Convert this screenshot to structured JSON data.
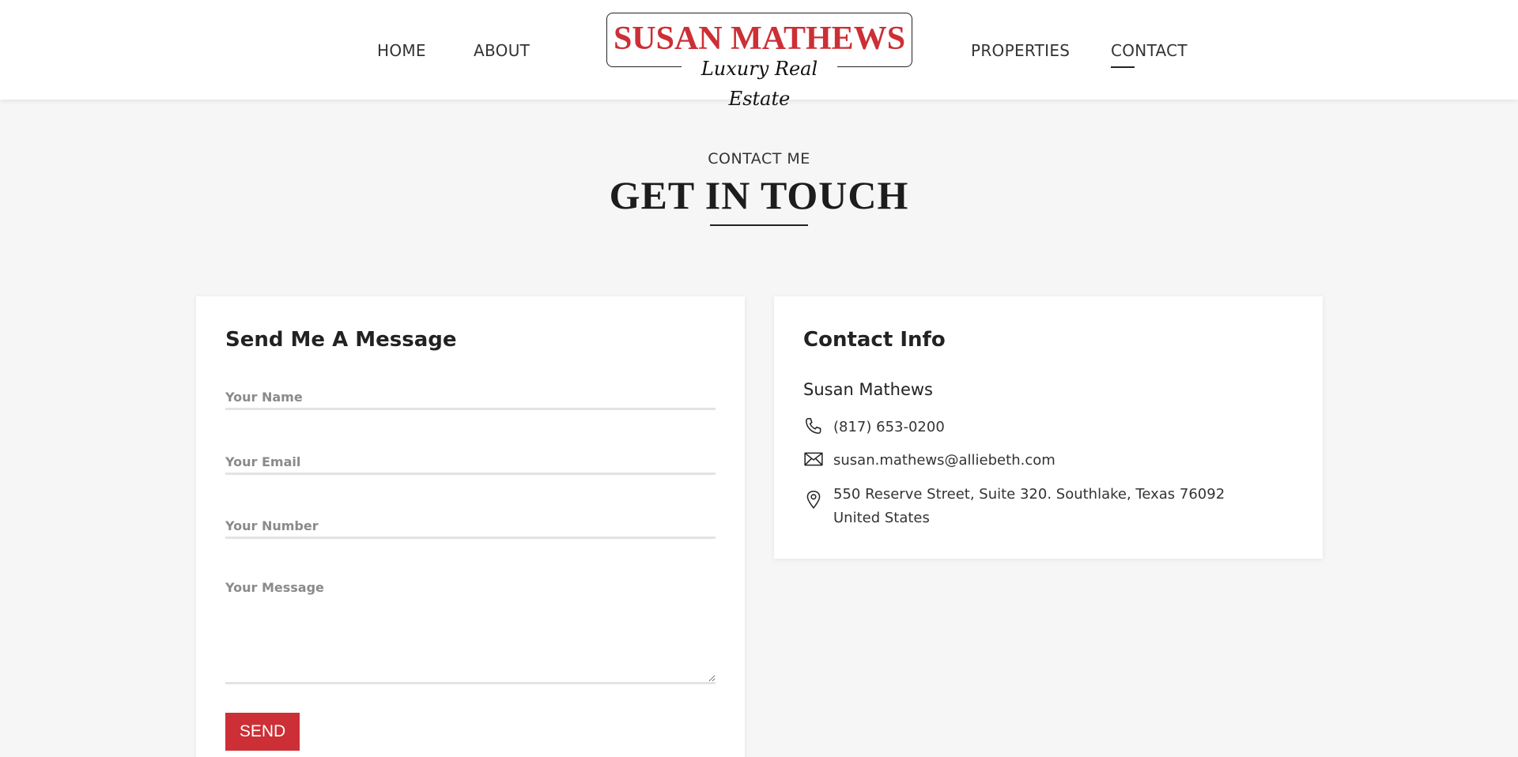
{
  "nav": {
    "home": "HOME",
    "about": "ABOUT",
    "properties": "PROPERTIES",
    "contact": "CONTACT"
  },
  "logo": {
    "name": "SUSAN MATHEWS",
    "tagline": "Luxury Real Estate"
  },
  "section": {
    "eyebrow": "CONTACT ME",
    "title": "GET IN TOUCH"
  },
  "form": {
    "title": "Send Me A Message",
    "name_placeholder": "Your Name",
    "email_placeholder": "Your Email",
    "number_placeholder": "Your Number",
    "message_placeholder": "Your Message",
    "send_label": "SEND"
  },
  "info": {
    "title": "Contact Info",
    "name": "Susan Mathews",
    "phone": "(817) 653-0200",
    "email": "susan.mathews@alliebeth.com",
    "address": "550 Reserve Street, Suite 320. Southlake, Texas 76092 United States"
  },
  "colors": {
    "brand_red": "#cc2f35",
    "background": "#f6f6f6",
    "text_dark": "#222222"
  },
  "icons": [
    "phone-icon",
    "mail-icon",
    "location-pin-icon"
  ]
}
